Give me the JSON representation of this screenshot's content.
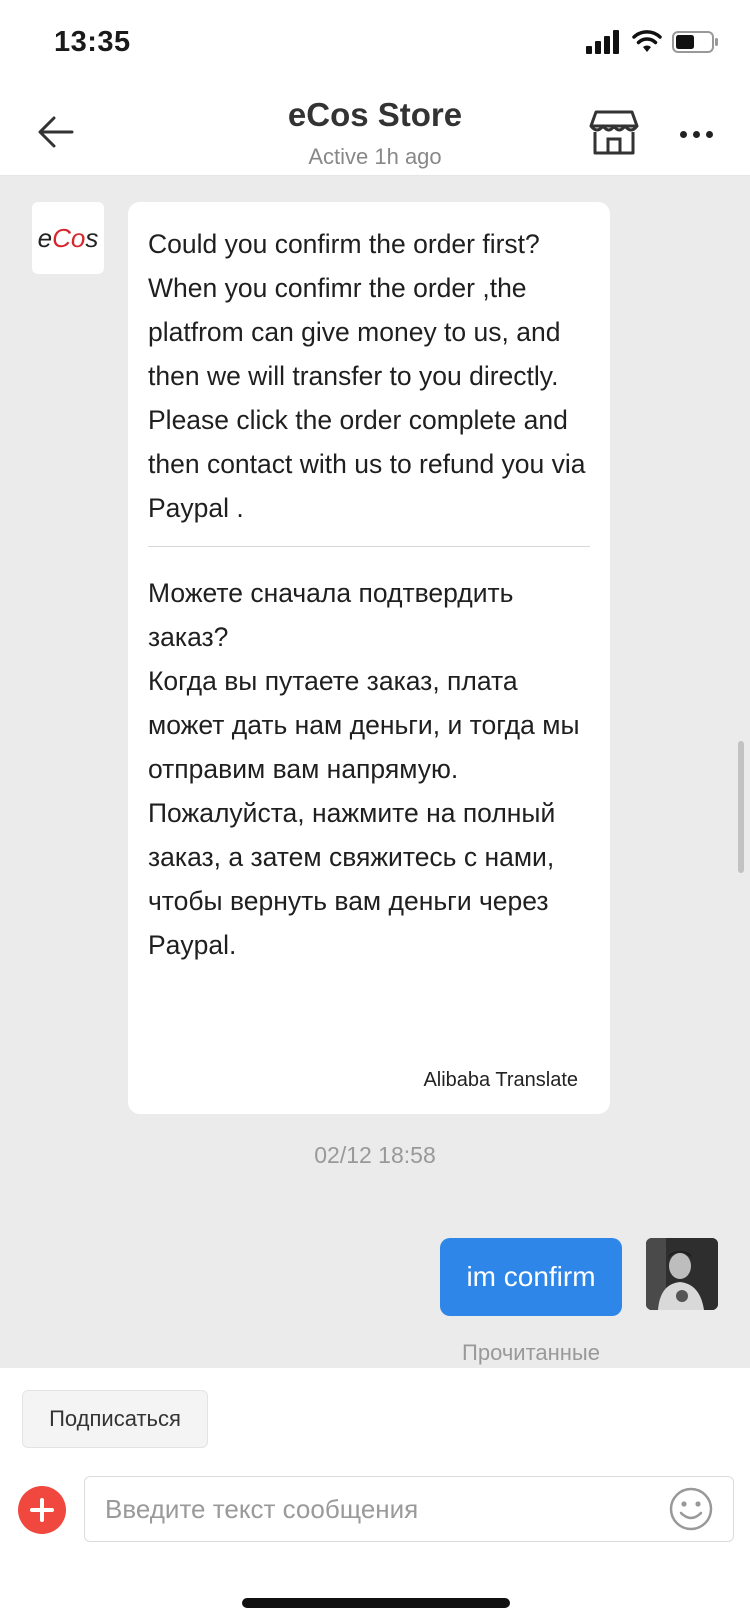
{
  "status_bar": {
    "time": "13:35"
  },
  "header": {
    "title": "eCos Store",
    "subtitle": "Active 1h ago"
  },
  "seller": {
    "avatar_prefix": "e",
    "avatar_highlight": "C",
    "avatar_mid": "o",
    "avatar_suffix": "s"
  },
  "messages": {
    "incoming": {
      "original": "Could you confirm the order first?\nWhen you confimr the order ,the platfrom can give money to us, and then we will transfer to you directly.\nPlease click the order complete and then contact with us to refund you via Paypal .",
      "translated": "Можете сначала подтвердить заказ?\nКогда вы путаете заказ, плата может дать нам деньги, и тогда мы отправим вам напрямую.\nПожалуйста, нажмите на полный заказ, а затем свяжитесь с нами, чтобы вернуть вам деньги через Paypal.",
      "translate_tag": "Alibaba Translate"
    },
    "timestamp": "02/12 18:58",
    "outgoing": {
      "text": "im confirm",
      "status": "Прочитанные"
    }
  },
  "bottom": {
    "subscribe_label": "Подписаться",
    "input_placeholder": "Введите текст сообщения"
  },
  "colors": {
    "outgoing_bubble": "#2d86e8",
    "add_button": "#f0483e",
    "chat_background": "#ebebeb"
  },
  "icons": {
    "back": "arrow-left-icon",
    "store": "store-icon",
    "more": "more-dots-icon",
    "add": "plus-icon",
    "emoji": "smiley-icon",
    "signal": "signal-icon",
    "wifi": "wifi-icon",
    "battery": "battery-icon"
  }
}
